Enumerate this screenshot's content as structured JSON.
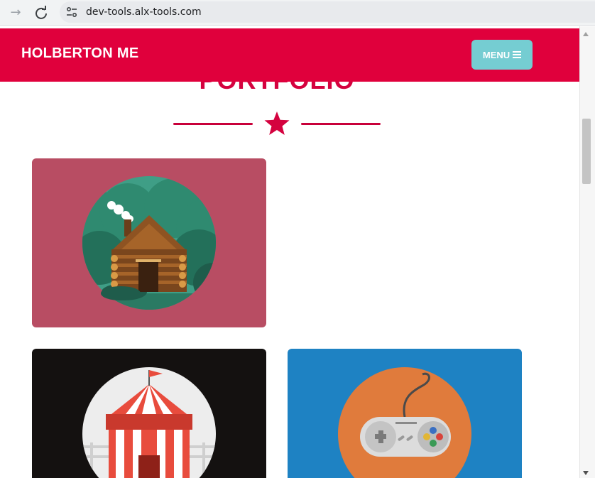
{
  "browser": {
    "url": "dev-tools.alx-tools.com",
    "forward_icon": "arrow-forward-icon",
    "reload_icon": "reload-icon",
    "site_info_icon": "tune-icon"
  },
  "navbar": {
    "brand": "HOLBERTON ME",
    "menu_label": "MENU",
    "menu_icon": "hamburger-icon",
    "color": "#e0003c",
    "menu_color": "#75cdd2"
  },
  "portfolio": {
    "title": "PORTFOLIO",
    "divider_icon": "star-icon",
    "accent_color": "#d4023f",
    "items": [
      {
        "name": "cabin",
        "background": "#b84d63"
      },
      {
        "name": "circus",
        "background": "#141110"
      },
      {
        "name": "game-controller",
        "background": "#1e82c3"
      }
    ]
  }
}
